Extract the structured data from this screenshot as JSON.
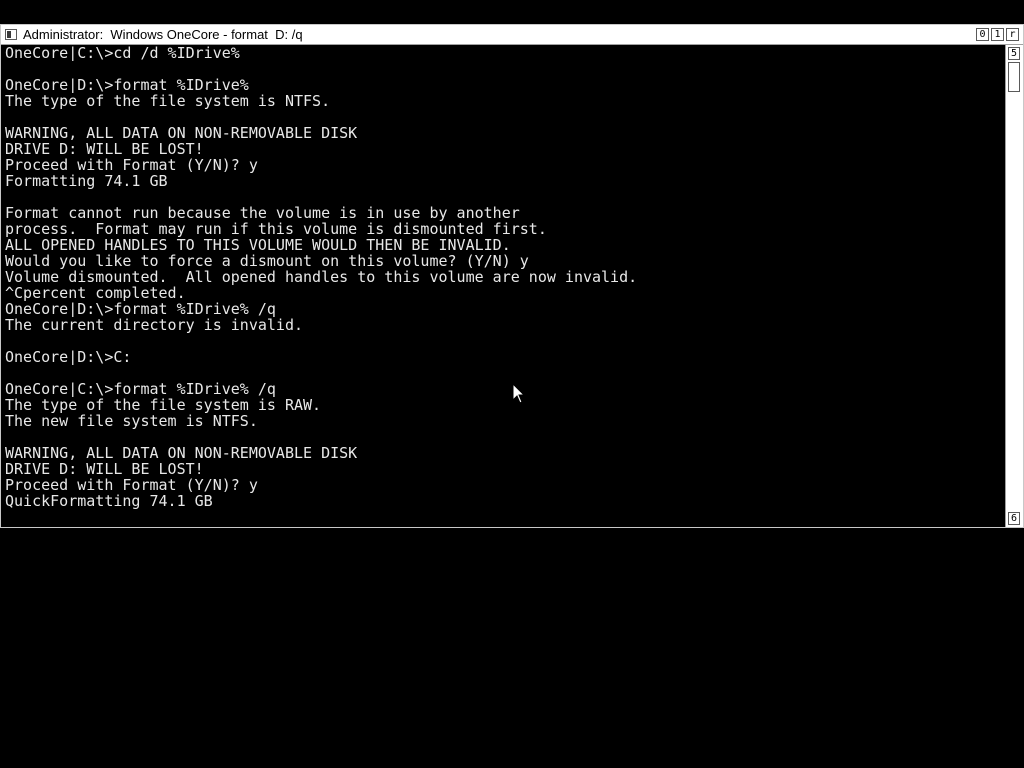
{
  "window": {
    "title": "Administrator:  Windows OneCore - format  D: /q",
    "controls": [
      "0",
      "1",
      "r"
    ],
    "scroll_up": "5",
    "scroll_down": "6"
  },
  "console": {
    "lines": [
      "OneCore|C:\\>cd /d %IDrive%",
      "",
      "OneCore|D:\\>format %IDrive%",
      "The type of the file system is NTFS.",
      "",
      "WARNING, ALL DATA ON NON-REMOVABLE DISK",
      "DRIVE D: WILL BE LOST!",
      "Proceed with Format (Y/N)? y",
      "Formatting 74.1 GB",
      "",
      "Format cannot run because the volume is in use by another",
      "process.  Format may run if this volume is dismounted first.",
      "ALL OPENED HANDLES TO THIS VOLUME WOULD THEN BE INVALID.",
      "Would you like to force a dismount on this volume? (Y/N) y",
      "Volume dismounted.  All opened handles to this volume are now invalid.",
      "^Cpercent completed.",
      "OneCore|D:\\>format %IDrive% /q",
      "The current directory is invalid.",
      "",
      "OneCore|D:\\>C:",
      "",
      "OneCore|C:\\>format %IDrive% /q",
      "The type of the file system is RAW.",
      "The new file system is NTFS.",
      "",
      "WARNING, ALL DATA ON NON-REMOVABLE DISK",
      "DRIVE D: WILL BE LOST!",
      "Proceed with Format (Y/N)? y",
      "QuickFormatting 74.1 GB"
    ]
  },
  "colors": {
    "console_bg": "#000000",
    "console_fg": "#e8e8e8",
    "titlebar_bg": "#ffffff"
  },
  "icons": {
    "window_icon": "console-window-icon",
    "pointer": "mouse-pointer-icon"
  }
}
